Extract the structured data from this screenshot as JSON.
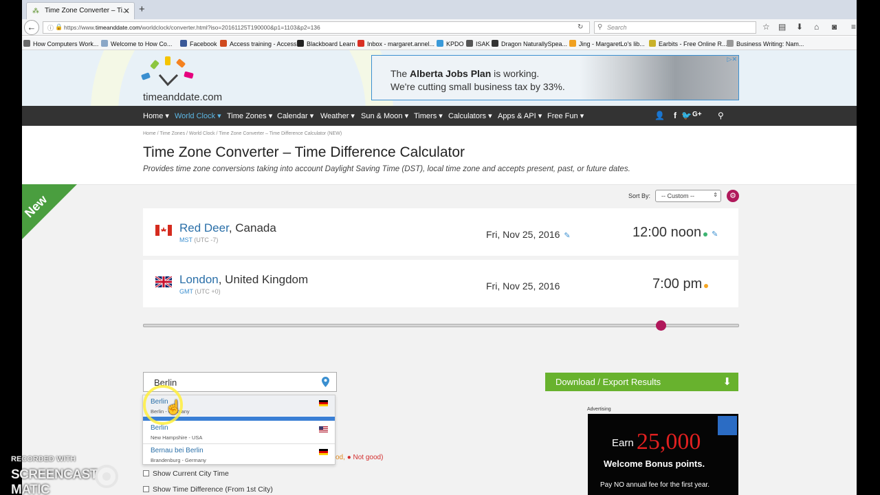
{
  "browser": {
    "tab_title": "Time Zone Converter – Ti...",
    "url_prefix": "https://www.",
    "url_host": "timeanddate.com",
    "url_path": "/worldclock/converter.html?iso=20161125T190000&p1=1103&p2=136",
    "search_placeholder": "Search",
    "bookmarks": [
      {
        "label": "How Computers Work...",
        "color": "#6a6a6a"
      },
      {
        "label": "Welcome to How Co...",
        "color": "#8aa7c7"
      },
      {
        "label": "Facebook",
        "color": "#3b5998"
      },
      {
        "label": "Access training - Access",
        "color": "#d04a1e"
      },
      {
        "label": "Blackboard Learn",
        "color": "#222222"
      },
      {
        "label": "Inbox - margaret.annel...",
        "color": "#d93025"
      },
      {
        "label": "KPDO",
        "color": "#3a9ad9"
      },
      {
        "label": "ISAK",
        "color": "#555555"
      },
      {
        "label": "Dragon NaturallySpea...",
        "color": "#333333"
      },
      {
        "label": "Jing - MargaretLo's lib...",
        "color": "#f0a020"
      },
      {
        "label": "Earbits - Free Online R...",
        "color": "#c9b12a"
      },
      {
        "label": "Business Writing: Nam...",
        "color": "#999999"
      }
    ]
  },
  "site": {
    "logo_text": "timeanddate.com",
    "ad": {
      "line1_pre": "The ",
      "line1_bold": "Alberta Jobs Plan",
      "line1_post": " is working.",
      "line2": "We're cutting small business tax by 33%."
    },
    "nav": [
      {
        "label": "Home",
        "active": false
      },
      {
        "label": "World Clock",
        "active": true
      },
      {
        "label": "Time Zones",
        "active": false
      },
      {
        "label": "Calendar",
        "active": false
      },
      {
        "label": "Weather",
        "active": false
      },
      {
        "label": "Sun & Moon",
        "active": false
      },
      {
        "label": "Timers",
        "active": false
      },
      {
        "label": "Calculators",
        "active": false
      },
      {
        "label": "Apps & API",
        "active": false
      },
      {
        "label": "Free Fun",
        "active": false
      }
    ],
    "social": "f  G+"
  },
  "page": {
    "breadcrumbs": "Home /  Time Zones /  World Clock /  Time Zone Converter – Time Difference Calculator (NEW)",
    "title": "Time Zone Converter – Time Difference Calculator",
    "subtitle": "Provides time zone conversions taking into account Daylight Saving Time (DST), local time zone and accepts present, past, or future dates.",
    "new_badge": "New",
    "sort_label": "Sort By:",
    "sort_value": "-- Custom --",
    "cities": [
      {
        "city": "Red Deer",
        "country": ", Canada",
        "tz": "MST",
        "utc": "(UTC -7)",
        "date": "Fri, Nov 25, 2016",
        "time": "12:00 noon",
        "dot_color": "#3cb371",
        "flag": "canada"
      },
      {
        "city": "London",
        "country": ", United Kingdom",
        "tz": "GMT",
        "utc": "(UTC +0)",
        "date": "Fri, Nov 25, 2016",
        "time": "7:00 pm",
        "dot_color": "#f5a623",
        "flag": "uk"
      }
    ],
    "search_value": "Berlin",
    "suggestions": [
      {
        "name": "Berlin",
        "location": "Berlin - Germany",
        "flag": "de"
      },
      {
        "name": "Berlin",
        "location": "New Hampshire - USA",
        "flag": "us"
      },
      {
        "name": "Bernau bei Berlin",
        "location": "Brandenburg - Germany",
        "flag": "de"
      }
    ],
    "legend_ok": "od,",
    "legend_bad": "Not good)",
    "options": [
      "Show Current City Time",
      "Show Time Difference (From 1st City)"
    ],
    "download_label": "Download / Export Results",
    "advertising_label": "Advertising",
    "amex": {
      "earn": "Earn ",
      "points": "25,000",
      "welcome": "Welcome Bonus points.",
      "fee": "Pay NO annual fee for the first year."
    }
  },
  "overlay": {
    "recorded_with": "RECORDED WITH",
    "brand_pre": "SCREENCAST",
    "brand_post": "MATIC"
  }
}
